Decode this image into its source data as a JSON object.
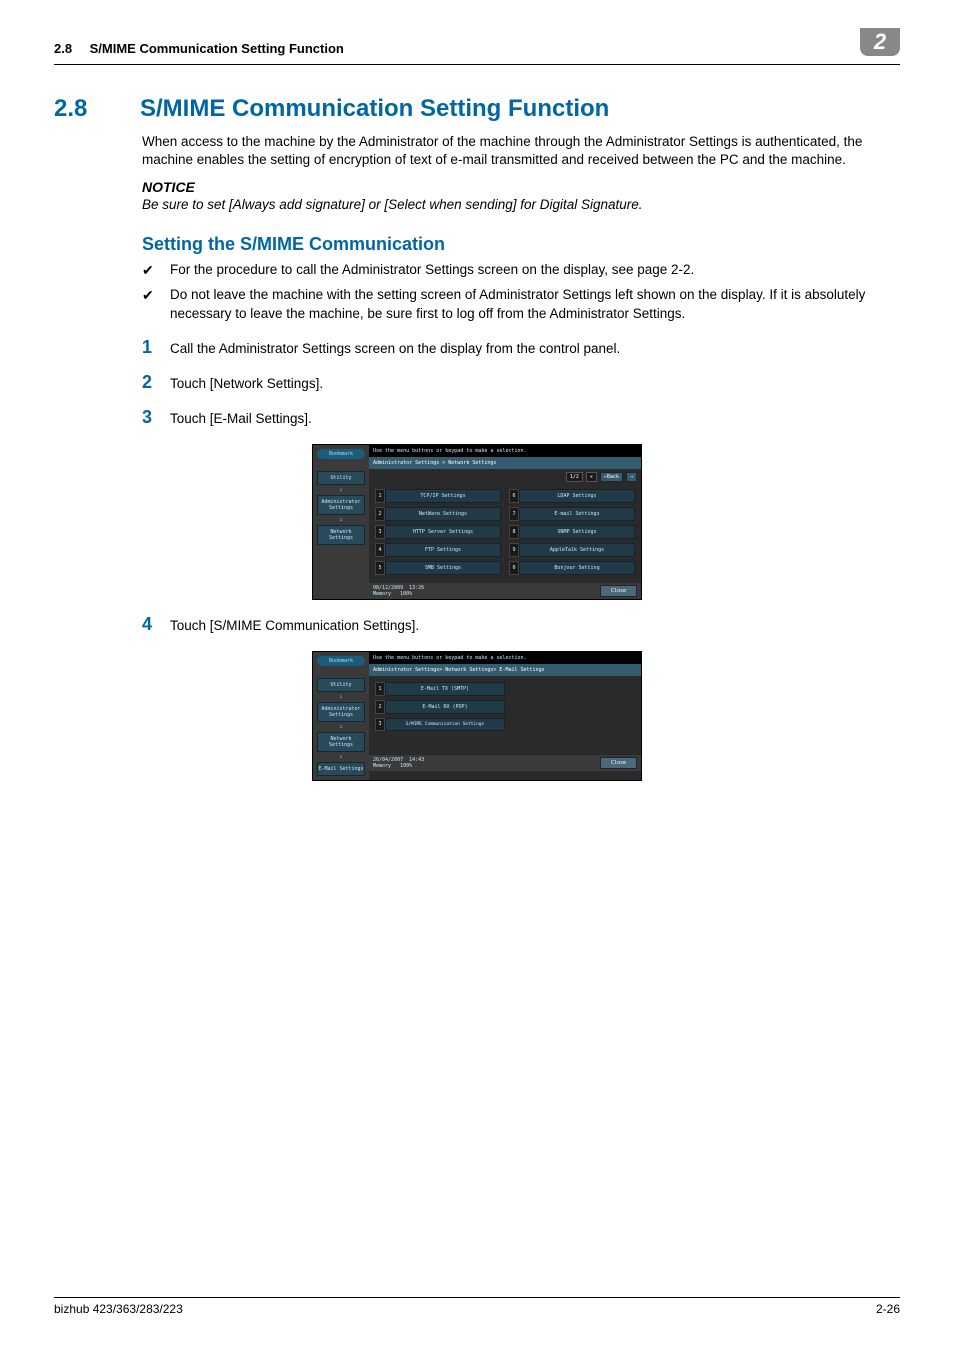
{
  "header": {
    "section_number": "2.8",
    "section_title_short": "S/MIME Communication Setting Function",
    "chapter_badge": "2"
  },
  "title": {
    "number": "2.8",
    "text": "S/MIME Communication Setting Function"
  },
  "intro_paragraph": "When access to the machine by the Administrator of the machine through the Administrator Settings is authenticated, the machine enables the setting of encryption of text of e-mail transmitted and received between the PC and the machine.",
  "notice": {
    "label": "NOTICE",
    "text": "Be sure to set [Always add signature] or [Select when sending] for Digital Signature."
  },
  "subheading": "Setting the S/MIME Communication",
  "bullets": [
    "For the procedure to call the Administrator Settings screen on the display, see page 2-2.",
    "Do not leave the machine with the setting screen of Administrator Settings left shown on the display. If it is absolutely necessary to leave the machine, be sure first to log off from the Administrator Settings."
  ],
  "steps": [
    {
      "n": "1",
      "text": "Call the Administrator Settings screen on the display from the control panel."
    },
    {
      "n": "2",
      "text": "Touch [Network Settings]."
    },
    {
      "n": "3",
      "text": "Touch [E-Mail Settings]."
    },
    {
      "n": "4",
      "text": "Touch [S/MIME Communication Settings]."
    }
  ],
  "shot1": {
    "prompt": "Use the menu buttons or keypad to make a selection.",
    "breadcrumb": "Administrator Settings > Network Settings",
    "bookmark": "Bookmark",
    "sidebar": [
      "Utility",
      "Administrator Settings",
      "Network Settings"
    ],
    "pager": {
      "page": "1/2",
      "back": "←Back",
      "fwd": "→"
    },
    "left": [
      {
        "n": "1",
        "label": "TCP/IP Settings"
      },
      {
        "n": "2",
        "label": "NetWare Settings"
      },
      {
        "n": "3",
        "label": "HTTP Server Settings"
      },
      {
        "n": "4",
        "label": "FTP Settings"
      },
      {
        "n": "5",
        "label": "SMB Settings"
      }
    ],
    "right": [
      {
        "n": "6",
        "label": "LDAP Settings"
      },
      {
        "n": "7",
        "label": "E-mail Settings"
      },
      {
        "n": "8",
        "label": "SNMP Settings"
      },
      {
        "n": "9",
        "label": "AppleTalk Settings"
      },
      {
        "n": "0",
        "label": "Bonjour Setting"
      }
    ],
    "footer_date": "08/12/2009",
    "footer_time": "13:26",
    "footer_mem": "Memory",
    "footer_pct": "100%",
    "close": "Close"
  },
  "shot2": {
    "prompt": "Use the menu buttons or keypad to make a selection.",
    "breadcrumb": "Administrator Settings> Network Settings> E-Mail Settings",
    "bookmark": "Bookmark",
    "sidebar": [
      "Utility",
      "Administrator Settings",
      "Network Settings",
      "E-Mail Settings"
    ],
    "items": [
      {
        "n": "1",
        "label": "E-Mail TX (SMTP)"
      },
      {
        "n": "2",
        "label": "E-Mail RX (POP)"
      },
      {
        "n": "3",
        "label": "S/MIME Communication Settings"
      }
    ],
    "footer_date": "26/04/2007",
    "footer_time": "14:43",
    "footer_mem": "Memory",
    "footer_pct": "100%",
    "close": "Close"
  },
  "footer": {
    "left": "bizhub 423/363/283/223",
    "right": "2-26"
  }
}
